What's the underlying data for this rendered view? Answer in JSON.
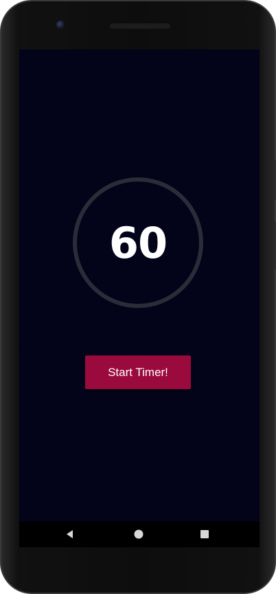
{
  "timer": {
    "value": "60"
  },
  "actions": {
    "start_label": "Start Timer!"
  },
  "nav": {
    "back_icon": "triangle-back-icon",
    "home_icon": "circle-home-icon",
    "recents_icon": "square-recents-icon"
  },
  "colors": {
    "screen_background": "#03031a",
    "ring": "#2c2c38",
    "button": "#9a0a3c",
    "text": "#ffffff"
  }
}
